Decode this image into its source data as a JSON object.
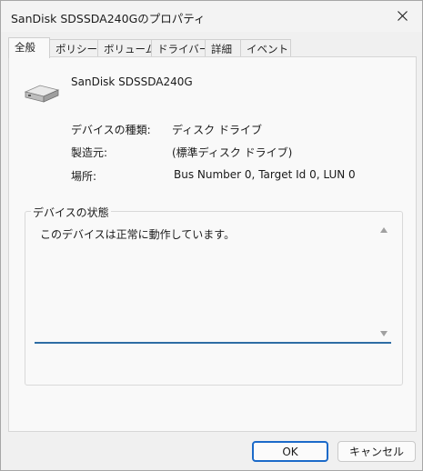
{
  "window": {
    "title": "SanDisk SDSSDA240Gのプロパティ"
  },
  "tabs": [
    {
      "label": "全般"
    },
    {
      "label": "ポリシー"
    },
    {
      "label": "ボリューム"
    },
    {
      "label": "ドライバー"
    },
    {
      "label": "詳細"
    },
    {
      "label": "イベント"
    }
  ],
  "general": {
    "device_name": "SanDisk SDSSDA240G",
    "device_type_label": "デバイスの種類:",
    "device_type_value": "ディスク ドライブ",
    "manufacturer_label": "製造元:",
    "manufacturer_value": "(標準ディスク ドライブ)",
    "location_label": "場所:",
    "location_value": "Bus Number 0, Target Id 0, LUN 0",
    "status_group_label": "デバイスの状態",
    "status_text": "このデバイスは正常に動作しています。"
  },
  "buttons": {
    "ok": "OK",
    "cancel": "キャンセル"
  },
  "icons": {
    "device": "drive-icon",
    "close": "close-icon"
  }
}
